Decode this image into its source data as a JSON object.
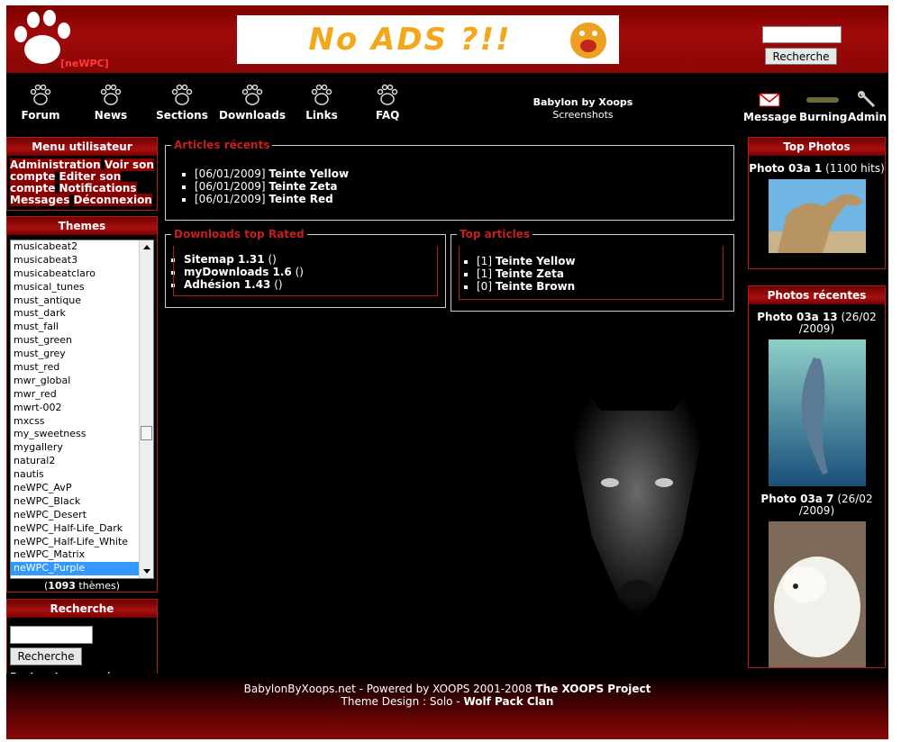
{
  "banner": {
    "text": "No ADS ?!!"
  },
  "logo": {
    "text": "[neWPC]"
  },
  "header_search": {
    "button": "Recherche"
  },
  "nav": [
    {
      "label": "Forum"
    },
    {
      "label": "News"
    },
    {
      "label": "Sections"
    },
    {
      "label": "Downloads"
    },
    {
      "label": "Links"
    },
    {
      "label": "FAQ"
    }
  ],
  "site": {
    "name": "Babylon by Xoops",
    "slogan": "Screenshots"
  },
  "right_nav": {
    "message": "Message",
    "burning": "Burning",
    "admin": "Admin"
  },
  "usermenu": {
    "title": "Menu utilisateur",
    "links": [
      "Administration",
      "Voir son compte",
      "Editer son compte",
      "Notifications",
      "Messages",
      "Déconnexion"
    ]
  },
  "themes": {
    "title": "Themes",
    "items": [
      "musicabeat2",
      "musicabeat3",
      "musicabeatclaro",
      "musical_tunes",
      "must_antique",
      "must_dark",
      "must_fall",
      "must_green",
      "must_grey",
      "must_red",
      "mwr_global",
      "mwr_red",
      "mwrt-002",
      "mxcss",
      "my_sweetness",
      "mygallery",
      "natural2",
      "nautis",
      "neWPC_AvP",
      "neWPC_Black",
      "neWPC_Desert",
      "neWPC_Half-Life_Dark",
      "neWPC_Half-Life_White",
      "neWPC_Matrix",
      "neWPC_Purple"
    ],
    "selected": "neWPC_Purple",
    "count_num": "1093",
    "count_label": "thèmes"
  },
  "side_search": {
    "title": "Recherche",
    "button": "Recherche",
    "advanced": "Recherche avancée"
  },
  "recent_articles": {
    "title": "Articles récents",
    "items": [
      {
        "date": "[06/01/2009]",
        "title": "Teinte Yellow"
      },
      {
        "date": "[06/01/2009]",
        "title": "Teinte Zeta"
      },
      {
        "date": "[06/01/2009]",
        "title": "Teinte Red"
      }
    ]
  },
  "downloads_top": {
    "title": "Downloads top Rated",
    "items": [
      {
        "name": "Sitemap 1.31",
        "extra": "()"
      },
      {
        "name": "myDownloads 1.6",
        "extra": "()"
      },
      {
        "name": "Adhésion 1.43",
        "extra": "()"
      }
    ]
  },
  "top_articles": {
    "title": "Top articles",
    "items": [
      {
        "count": "[1]",
        "title": "Teinte Yellow"
      },
      {
        "count": "[1]",
        "title": "Teinte Zeta"
      },
      {
        "count": "[0]",
        "title": "Teinte Brown"
      }
    ]
  },
  "top_photos": {
    "title": "Top Photos",
    "items": [
      {
        "name": "Photo 03a 1",
        "meta": "(1100 hits)"
      }
    ]
  },
  "recent_photos": {
    "title": "Photos récentes",
    "items": [
      {
        "name": "Photo 03a 13",
        "meta": "(26/02 /2009)"
      },
      {
        "name": "Photo 03a 7",
        "meta": "(26/02 /2009)"
      }
    ]
  },
  "footer": {
    "line1_prefix": "BabylonByXoops.net - Powered by XOOPS 2001-2008",
    "line1_link": "The XOOPS Project",
    "line2_prefix": "Theme Design : Solo -",
    "line2_link": "Wolf Pack Clan"
  },
  "colors": {
    "accent_red": "#b51a1a",
    "legend_red": "#c81e1e",
    "header_red": "#a10a0a",
    "background": "#000000"
  }
}
